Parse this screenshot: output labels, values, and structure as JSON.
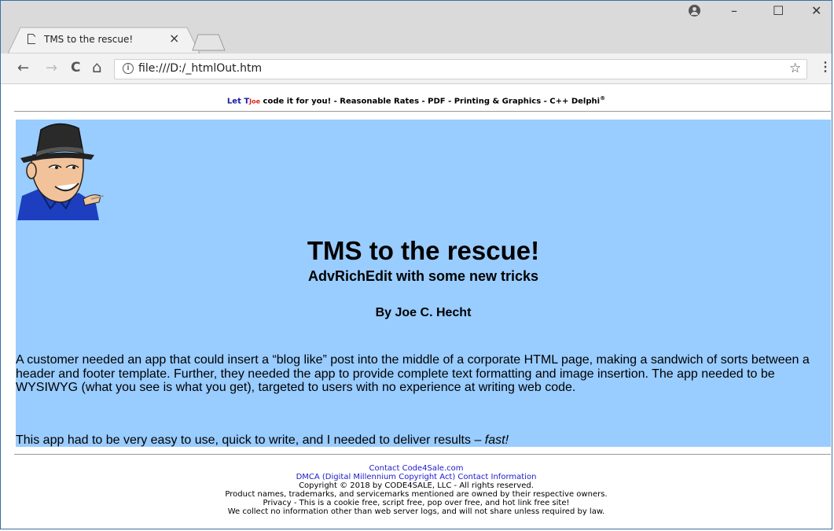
{
  "browser": {
    "tab_title": "TMS to the rescue!",
    "tab_close": "×",
    "url": "file:///D:/_htmlOut.htm",
    "info_icon": "i",
    "window_controls": {
      "minimize": "–",
      "maximize": "☐",
      "close": "✕"
    },
    "nav": {
      "back": "←",
      "forward": "→",
      "reload": "C",
      "home": "⌂"
    },
    "bookmark_star": "☆",
    "menu": "⋮"
  },
  "ad_banner": {
    "let": "Let T",
    "joe": "Joe",
    "rest": " code it for you! - Reasonable Rates - PDF - Printing & Graphics - C++ Delphi",
    "reg": "®"
  },
  "article": {
    "title": "TMS to the rescue!",
    "subtitle": "AdvRichEdit with some new tricks",
    "byline": "By Joe C. Hecht",
    "paragraph1": "A customer needed an app that could insert a “blog like” post into the middle of a corporate HTML page, making a sandwich of sorts between a header and footer template. Further, they needed the app to provide complete text formatting and image insertion. The app needed to be WYSIWYG (what you see is what you get), targeted to users with no experience at writing web code.",
    "paragraph2_start": "This app had to be very easy to use, quick to write, and I needed to deliver results – ",
    "paragraph2_emph": "fast!"
  },
  "footer": {
    "contact_link": "Contact Code4Sale.com",
    "dmca_link": "DMCA (Digital Millennium Copyright Act) Contact Information",
    "copyright": "Copyright © 2018 by CODE4SALE, LLC - All rights reserved.",
    "trademarks": "Product names, trademarks, and servicemarks mentioned are owned by their respective owners.",
    "privacy": "Privacy - This is a cookie free, script free, pop over free, and hot link free site!",
    "logs": "We collect no information other than web server logs, and will not share unless required by law."
  },
  "colors": {
    "hero_bg": "#99ccff",
    "link": "#1a1ac8"
  }
}
